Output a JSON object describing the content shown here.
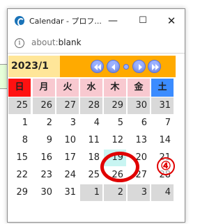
{
  "window": {
    "title": "Calendar - プロフ...",
    "minimize_glyph": "—",
    "maximize_glyph": "☐",
    "close_glyph": "✕"
  },
  "addressbar": {
    "info_glyph": "i",
    "url_scheme": "about:",
    "url_rest": "blank"
  },
  "calendar": {
    "month_label": "2023/1",
    "accent_colors": {
      "header": "#ffaa00",
      "sunday": "#ff1111",
      "saturday": "#3b8cff",
      "today": "#c8f5f2"
    },
    "nav_buttons": [
      "prev-year",
      "prev-month",
      "today",
      "next-month",
      "next-year"
    ],
    "weekdays": [
      "日",
      "月",
      "火",
      "水",
      "木",
      "金",
      "土"
    ],
    "weeks": [
      [
        "25",
        "26",
        "27",
        "28",
        "29",
        "30",
        "31"
      ],
      [
        "1",
        "2",
        "3",
        "4",
        "5",
        "6",
        "7"
      ],
      [
        "8",
        "9",
        "10",
        "11",
        "12",
        "13",
        "14"
      ],
      [
        "15",
        "16",
        "17",
        "18",
        "19",
        "20",
        "21"
      ],
      [
        "22",
        "23",
        "24",
        "25",
        "26",
        "27",
        "28"
      ],
      [
        "29",
        "30",
        "31",
        "1",
        "2",
        "3",
        "4"
      ]
    ],
    "other_month_cells": [
      [
        0,
        0
      ],
      [
        0,
        1
      ],
      [
        0,
        2
      ],
      [
        0,
        3
      ],
      [
        0,
        4
      ],
      [
        0,
        5
      ],
      [
        0,
        6
      ],
      [
        5,
        3
      ],
      [
        5,
        4
      ],
      [
        5,
        5
      ],
      [
        5,
        6
      ]
    ],
    "today_cell": [
      3,
      4
    ]
  },
  "annotation": {
    "number": "④"
  }
}
